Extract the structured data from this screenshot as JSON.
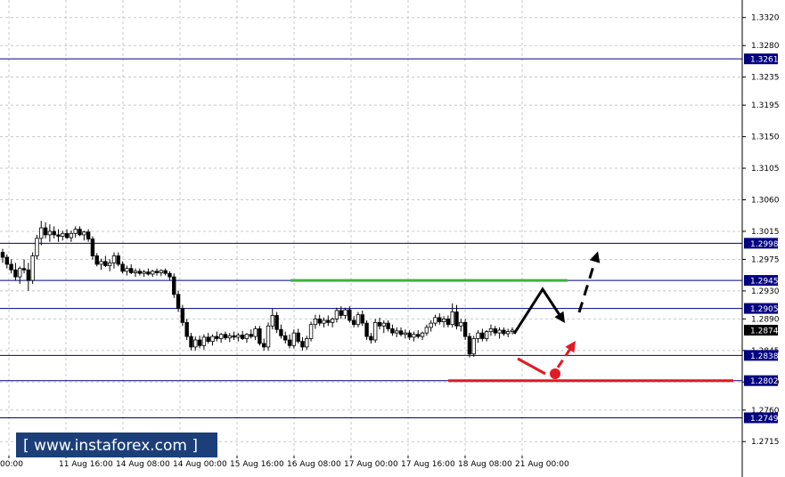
{
  "watermark": {
    "text": "[ www.instaforex.com ]"
  },
  "colors": {
    "background": "#ffffff",
    "grid": "#c8c8c8",
    "level_line": "#000080",
    "level_label_bg": "#000080",
    "bull_candle": "#ffffff",
    "bear_candle": "#000000",
    "green_target": "#3cb43c",
    "red_target": "#e01b24",
    "brand_bg": "#1c3f7a",
    "price_label_bg": "#000000"
  },
  "chart_data": {
    "type": "candlestick",
    "symbol_axis": "price",
    "ylim": [
      1.2695,
      1.3345
    ],
    "yticks": [
      1.332,
      1.328,
      1.3235,
      1.3195,
      1.315,
      1.3105,
      1.306,
      1.3015,
      1.2975,
      1.293,
      1.289,
      1.2845,
      1.28,
      1.276,
      1.2715
    ],
    "xticks": [
      "00:00",
      "11 Aug 16:00",
      "14 Aug 08:00",
      "14 Aug 00:00",
      "15 Aug 16:00",
      "16 Aug 08:00",
      "17 Aug 00:00",
      "17 Aug 16:00",
      "18 Aug 08:00",
      "21 Aug 00:00"
    ],
    "levels": [
      {
        "value": 1.3261,
        "label": "1.3261"
      },
      {
        "value": 1.2998,
        "label": "1.2998"
      },
      {
        "value": 1.2945,
        "label": "1.2945"
      },
      {
        "value": 1.2905,
        "label": "1.2905"
      },
      {
        "value": 1.2838,
        "label": "1.2838"
      },
      {
        "value": 1.2802,
        "label": "1.2802"
      },
      {
        "value": 1.2749,
        "label": "1.2749"
      }
    ],
    "current_price": {
      "value": 1.2874,
      "label": "1.2874"
    },
    "candles": [
      [
        1.2985,
        1.299,
        1.297,
        1.2978
      ],
      [
        1.2978,
        1.2982,
        1.2962,
        1.2968
      ],
      [
        1.2968,
        1.2975,
        1.2955,
        1.296
      ],
      [
        1.296,
        1.297,
        1.2945,
        1.295
      ],
      [
        1.295,
        1.2965,
        1.294,
        1.2962
      ],
      [
        1.2962,
        1.2975,
        1.2955,
        1.296
      ],
      [
        1.296,
        1.297,
        1.293,
        1.2945
      ],
      [
        1.2945,
        1.2985,
        1.294,
        1.298
      ],
      [
        1.298,
        1.301,
        1.2975,
        1.3005
      ],
      [
        1.3005,
        1.303,
        1.2995,
        1.302
      ],
      [
        1.302,
        1.3028,
        1.3005,
        1.301
      ],
      [
        1.301,
        1.3025,
        1.3,
        1.3015
      ],
      [
        1.3015,
        1.3022,
        1.3005,
        1.301
      ],
      [
        1.301,
        1.3018,
        1.3,
        1.3008
      ],
      [
        1.3008,
        1.3016,
        1.3002,
        1.3012
      ],
      [
        1.3012,
        1.3018,
        1.3004,
        1.3006
      ],
      [
        1.3006,
        1.3016,
        1.3,
        1.3012
      ],
      [
        1.3012,
        1.3022,
        1.3006,
        1.3018
      ],
      [
        1.3018,
        1.3022,
        1.3008,
        1.301
      ],
      [
        1.301,
        1.3016,
        1.3002,
        1.3014
      ],
      [
        1.3014,
        1.3018,
        1.3,
        1.3004
      ],
      [
        1.3004,
        1.3008,
        1.2975,
        1.298
      ],
      [
        1.298,
        1.2984,
        1.2965,
        1.2968
      ],
      [
        1.2968,
        1.2976,
        1.296,
        1.2972
      ],
      [
        1.2972,
        1.298,
        1.2964,
        1.2966
      ],
      [
        1.2966,
        1.2975,
        1.2958,
        1.297
      ],
      [
        1.297,
        1.2985,
        1.2962,
        1.298
      ],
      [
        1.298,
        1.2985,
        1.2965,
        1.2968
      ],
      [
        1.2968,
        1.2972,
        1.2955,
        1.2958
      ],
      [
        1.2958,
        1.2966,
        1.2952,
        1.2962
      ],
      [
        1.2962,
        1.2968,
        1.2954,
        1.2956
      ],
      [
        1.2956,
        1.2962,
        1.295,
        1.2958
      ],
      [
        1.2958,
        1.2962,
        1.2952,
        1.2955
      ],
      [
        1.2955,
        1.296,
        1.295,
        1.2957
      ],
      [
        1.2957,
        1.2962,
        1.2952,
        1.2954
      ],
      [
        1.2954,
        1.296,
        1.295,
        1.2958
      ],
      [
        1.2958,
        1.2962,
        1.2952,
        1.2956
      ],
      [
        1.2956,
        1.2961,
        1.2951,
        1.2959
      ],
      [
        1.2959,
        1.2962,
        1.2952,
        1.2955
      ],
      [
        1.2955,
        1.2958,
        1.2945,
        1.295
      ],
      [
        1.295,
        1.2955,
        1.292,
        1.2925
      ],
      [
        1.2925,
        1.293,
        1.29,
        1.2905
      ],
      [
        1.2905,
        1.291,
        1.288,
        1.2885
      ],
      [
        1.2885,
        1.289,
        1.286,
        1.2865
      ],
      [
        1.2865,
        1.287,
        1.2845,
        1.285
      ],
      [
        1.285,
        1.2865,
        1.2845,
        1.286
      ],
      [
        1.286,
        1.2866,
        1.2848,
        1.2852
      ],
      [
        1.2852,
        1.2868,
        1.2846,
        1.2864
      ],
      [
        1.2864,
        1.287,
        1.2855,
        1.2858
      ],
      [
        1.2858,
        1.2868,
        1.2852,
        1.2865
      ],
      [
        1.2865,
        1.2872,
        1.2858,
        1.2862
      ],
      [
        1.2862,
        1.287,
        1.2856,
        1.2868
      ],
      [
        1.2868,
        1.2872,
        1.286,
        1.2863
      ],
      [
        1.2863,
        1.287,
        1.2857,
        1.2866
      ],
      [
        1.2866,
        1.2872,
        1.286,
        1.2864
      ],
      [
        1.2864,
        1.287,
        1.2858,
        1.2867
      ],
      [
        1.2867,
        1.2873,
        1.286,
        1.2862
      ],
      [
        1.2862,
        1.287,
        1.2856,
        1.2868
      ],
      [
        1.2868,
        1.2875,
        1.2862,
        1.2865
      ],
      [
        1.2865,
        1.288,
        1.286,
        1.2876
      ],
      [
        1.2876,
        1.288,
        1.2852,
        1.2855
      ],
      [
        1.2855,
        1.2862,
        1.2845,
        1.285
      ],
      [
        1.285,
        1.2885,
        1.2845,
        1.288
      ],
      [
        1.288,
        1.2905,
        1.2875,
        1.2895
      ],
      [
        1.2895,
        1.29,
        1.287,
        1.2875
      ],
      [
        1.2875,
        1.2882,
        1.2862,
        1.2866
      ],
      [
        1.2866,
        1.2872,
        1.2855,
        1.286
      ],
      [
        1.286,
        1.2868,
        1.2848,
        1.2852
      ],
      [
        1.2852,
        1.2875,
        1.2848,
        1.287
      ],
      [
        1.287,
        1.2876,
        1.2855,
        1.2858
      ],
      [
        1.2858,
        1.2864,
        1.2845,
        1.285
      ],
      [
        1.285,
        1.2866,
        1.2846,
        1.2862
      ],
      [
        1.2862,
        1.2886,
        1.2858,
        1.2882
      ],
      [
        1.2882,
        1.2896,
        1.2876,
        1.289
      ],
      [
        1.289,
        1.2896,
        1.288,
        1.2884
      ],
      [
        1.2884,
        1.2892,
        1.2878,
        1.2888
      ],
      [
        1.2888,
        1.2895,
        1.288,
        1.2885
      ],
      [
        1.2885,
        1.2892,
        1.2878,
        1.289
      ],
      [
        1.289,
        1.2906,
        1.2885,
        1.2902
      ],
      [
        1.2902,
        1.2908,
        1.289,
        1.2895
      ],
      [
        1.2895,
        1.2906,
        1.289,
        1.2903
      ],
      [
        1.2903,
        1.2908,
        1.2885,
        1.2888
      ],
      [
        1.2888,
        1.2894,
        1.2878,
        1.2882
      ],
      [
        1.2882,
        1.29,
        1.2878,
        1.2896
      ],
      [
        1.2896,
        1.2902,
        1.288,
        1.2884
      ],
      [
        1.2884,
        1.2888,
        1.286,
        1.2865
      ],
      [
        1.2865,
        1.287,
        1.2855,
        1.286
      ],
      [
        1.286,
        1.289,
        1.2856,
        1.2885
      ],
      [
        1.2885,
        1.2892,
        1.2875,
        1.288
      ],
      [
        1.288,
        1.2888,
        1.287,
        1.2884
      ],
      [
        1.2884,
        1.2888,
        1.2872,
        1.2876
      ],
      [
        1.2876,
        1.2882,
        1.2866,
        1.287
      ],
      [
        1.287,
        1.2878,
        1.2864,
        1.2873
      ],
      [
        1.2873,
        1.2878,
        1.2865,
        1.2868
      ],
      [
        1.2868,
        1.2875,
        1.2862,
        1.287
      ],
      [
        1.287,
        1.2874,
        1.286,
        1.2864
      ],
      [
        1.2864,
        1.2872,
        1.2858,
        1.2868
      ],
      [
        1.2868,
        1.2874,
        1.2862,
        1.2865
      ],
      [
        1.2865,
        1.2872,
        1.286,
        1.287
      ],
      [
        1.287,
        1.2882,
        1.2866,
        1.2878
      ],
      [
        1.2878,
        1.2888,
        1.2872,
        1.2884
      ],
      [
        1.2884,
        1.2896,
        1.288,
        1.2892
      ],
      [
        1.2892,
        1.2898,
        1.2882,
        1.2886
      ],
      [
        1.2886,
        1.2894,
        1.2878,
        1.289
      ],
      [
        1.289,
        1.2895,
        1.2878,
        1.2882
      ],
      [
        1.2882,
        1.2912,
        1.2878,
        1.29
      ],
      [
        1.29,
        1.291,
        1.2875,
        1.288
      ],
      [
        1.288,
        1.289,
        1.2872,
        1.2885
      ],
      [
        1.2885,
        1.289,
        1.286,
        1.2865
      ],
      [
        1.2865,
        1.287,
        1.2835,
        1.284
      ],
      [
        1.284,
        1.2866,
        1.2836,
        1.2862
      ],
      [
        1.2862,
        1.2874,
        1.2856,
        1.287
      ],
      [
        1.287,
        1.2876,
        1.2858,
        1.2862
      ],
      [
        1.2862,
        1.2874,
        1.2858,
        1.2872
      ],
      [
        1.2872,
        1.2882,
        1.2866,
        1.2876
      ],
      [
        1.2876,
        1.288,
        1.2866,
        1.287
      ],
      [
        1.287,
        1.2878,
        1.2862,
        1.2874
      ],
      [
        1.2874,
        1.2878,
        1.2866,
        1.2869
      ],
      [
        1.2869,
        1.2876,
        1.2864,
        1.2872
      ],
      [
        1.2872,
        1.2878,
        1.2868,
        1.2874
      ]
    ],
    "projections": {
      "green_line": {
        "x_from_candle": 78,
        "x_to": "ahead",
        "value": 1.2945
      },
      "red_line": {
        "value": 1.2802
      }
    }
  }
}
